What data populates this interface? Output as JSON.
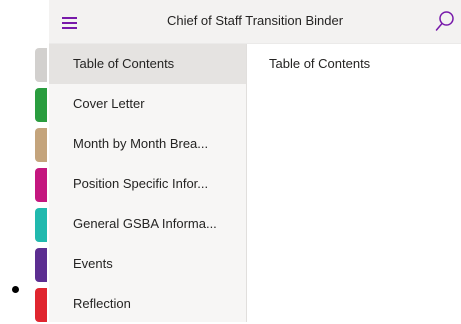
{
  "header": {
    "notebook_title": "Chief of Staff Transition Binder"
  },
  "icons": {
    "menu": "hamburger-menu-icon",
    "search": "search-icon"
  },
  "colors": {
    "accent": "#7719aa",
    "section_tabs": [
      "#d2d0ce",
      "#2a9d3f",
      "#c4a47c",
      "#c4177f",
      "#21b9ae",
      "#5c2e91",
      "#e0262f"
    ]
  },
  "sections": {
    "items": [
      {
        "label": "Table of Contents",
        "selected": true
      },
      {
        "label": "Cover Letter",
        "selected": false
      },
      {
        "label": "Month by Month Brea...",
        "selected": false
      },
      {
        "label": "Position Specific Infor...",
        "selected": false
      },
      {
        "label": "General GSBA Informa...",
        "selected": false
      },
      {
        "label": "Events",
        "selected": false
      },
      {
        "label": "Reflection",
        "selected": false
      }
    ]
  },
  "pages": {
    "items": [
      {
        "label": "Table of Contents"
      }
    ]
  }
}
